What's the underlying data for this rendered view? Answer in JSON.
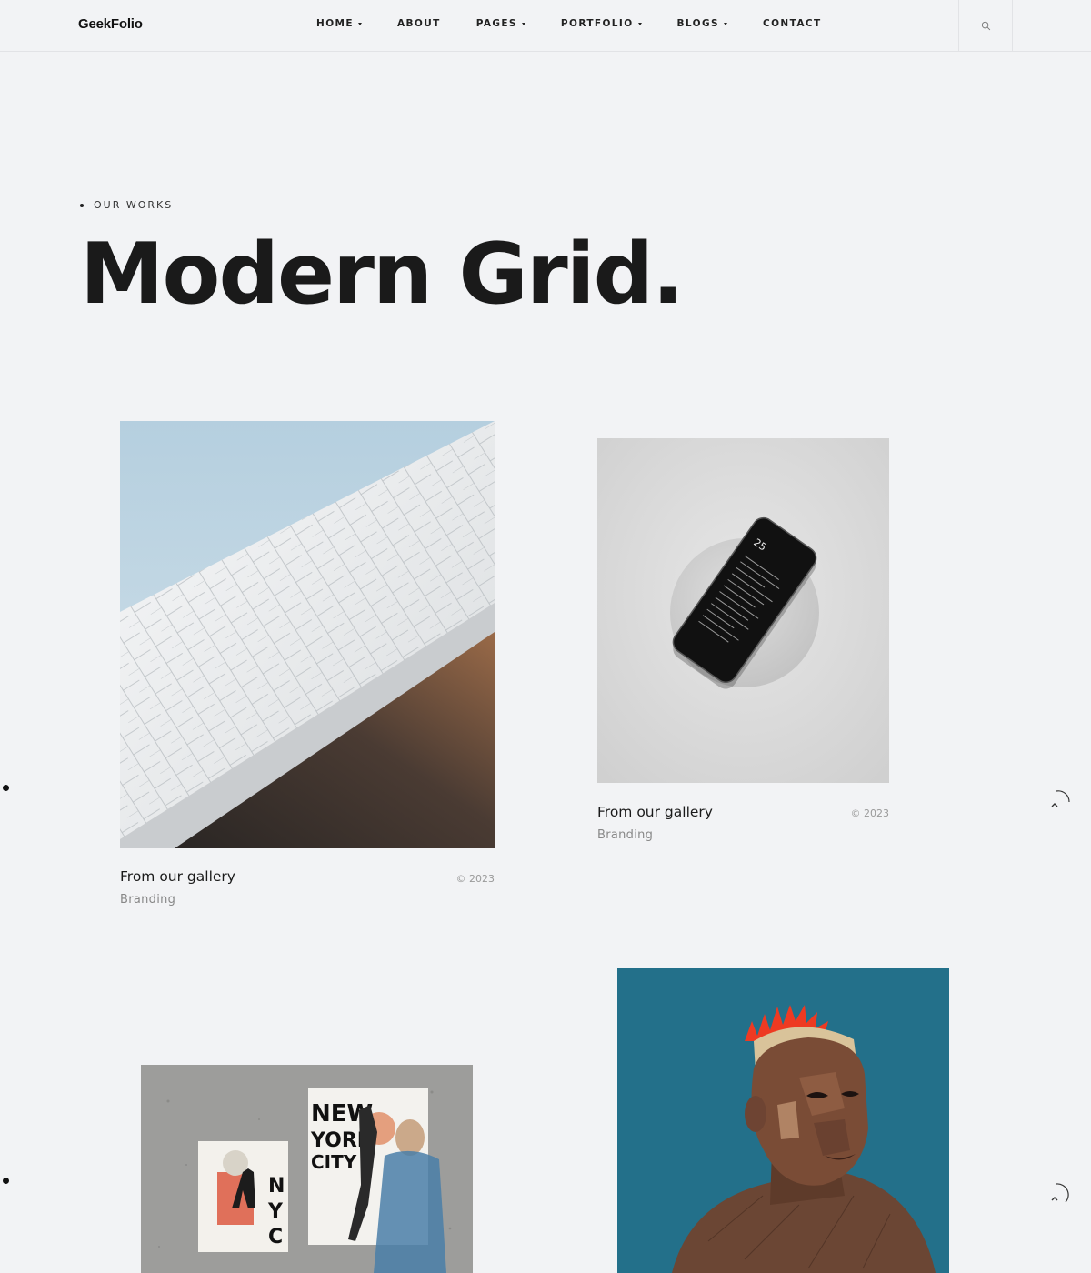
{
  "header": {
    "logo": "GeekFolio",
    "nav": [
      {
        "label": "HOME",
        "dropdown": true
      },
      {
        "label": "ABOUT",
        "dropdown": false
      },
      {
        "label": "PAGES",
        "dropdown": true
      },
      {
        "label": "PORTFOLIO",
        "dropdown": true
      },
      {
        "label": "BLOGS",
        "dropdown": true
      },
      {
        "label": "CONTACT",
        "dropdown": false
      }
    ],
    "search_icon": "search-icon"
  },
  "hero": {
    "eyebrow": "OUR WORKS",
    "title": "Modern Grid."
  },
  "works": [
    {
      "title": "From our gallery",
      "category": "Branding",
      "year": "© 2023",
      "image": "white-tiled-building"
    },
    {
      "title": "From our gallery",
      "category": "Branding",
      "year": "© 2023",
      "image": "phone-on-stone"
    },
    {
      "title": "",
      "category": "",
      "year": "",
      "image": "nyc-posters-wall"
    },
    {
      "title": "",
      "category": "",
      "year": "",
      "image": "portrait-illustration"
    }
  ],
  "poster_text": {
    "big": [
      "NEW",
      "YORK",
      "CITY"
    ],
    "small": [
      "N",
      "Y",
      "C"
    ]
  },
  "phone_screen_number": "25",
  "colors": {
    "background": "#f2f3f5",
    "text": "#1a1a1a",
    "muted": "#888888",
    "teal": "#23708a"
  }
}
